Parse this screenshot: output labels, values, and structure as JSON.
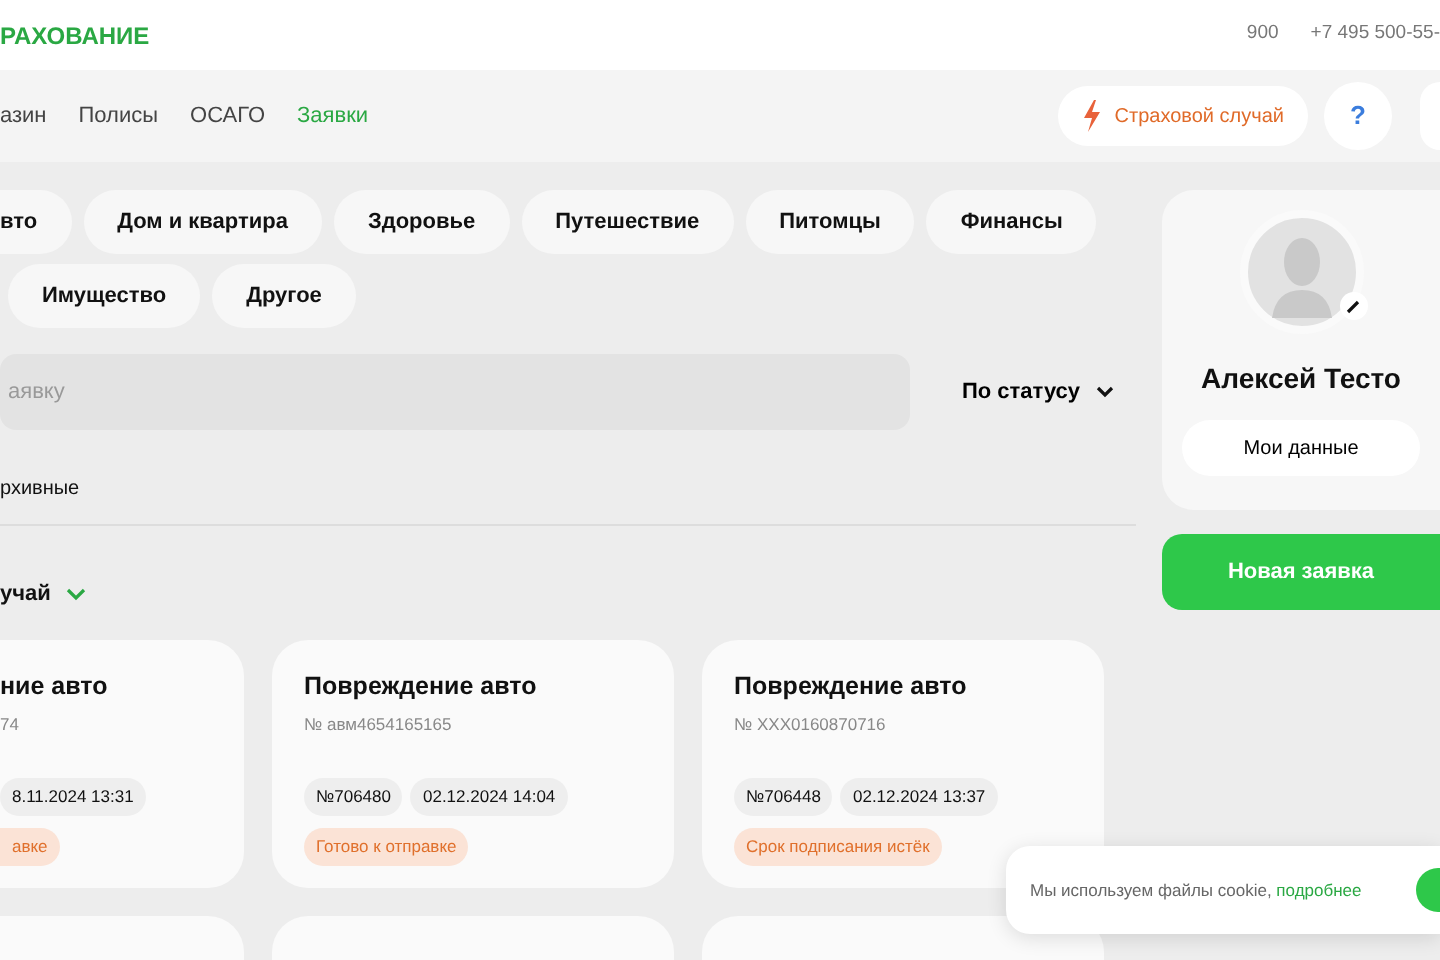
{
  "brand": "РАХОВАНИЕ",
  "header_links": [
    "900",
    "+7 495 500-55-"
  ],
  "nav": [
    {
      "label": "азин",
      "selected": false
    },
    {
      "label": "Полисы",
      "selected": false
    },
    {
      "label": "ОСАГО",
      "selected": false
    },
    {
      "label": "Заявки",
      "selected": true
    }
  ],
  "claim_button": "Страховой случай",
  "help_button": "?",
  "categories": [
    "вто",
    "Дом и квартира",
    "Здоровье",
    "Путешествие",
    "Питомцы",
    "Финансы",
    "Имущество",
    "Другое"
  ],
  "search": {
    "placeholder": "аявку"
  },
  "sort": "По статусу",
  "archive_label": "рхивные",
  "group_title": "учай",
  "cards": [
    {
      "title": "ние авто",
      "number": "74",
      "tags": [
        "8.11.2024 13:31"
      ],
      "status": "авке"
    },
    {
      "title": "Повреждение авто",
      "number": "№ авм4654165165",
      "tags": [
        "№706480",
        "02.12.2024 14:04"
      ],
      "status": "Готово к отправке"
    },
    {
      "title": "Повреждение авто",
      "number": "№ XXX0160870716",
      "tags": [
        "№706448",
        "02.12.2024 13:37"
      ],
      "status": "Срок подписания истёк"
    }
  ],
  "profile": {
    "name": "Алексей Тесто",
    "my_data": "Мои данные"
  },
  "new_request": "Новая заявка",
  "cookie": {
    "text": "Мы используем файлы cookie, ",
    "link": "подробнее"
  }
}
